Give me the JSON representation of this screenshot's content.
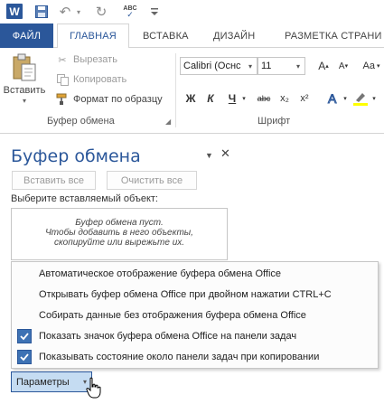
{
  "qat": {
    "word_logo": "W",
    "spell_top": "ABC",
    "spell_bottom": "✓",
    "icons": [
      "word-logo-icon",
      "save-icon",
      "undo-icon",
      "redo-icon",
      "spelling-icon",
      "customize-icon"
    ]
  },
  "tabs": {
    "file": "ФАЙЛ",
    "home": "ГЛАВНАЯ",
    "insert": "ВСТАВКА",
    "design": "ДИЗАЙН",
    "layout": "РАЗМЕТКА СТРАНИ"
  },
  "ribbon": {
    "paste": "Вставить",
    "cut": "Вырезать",
    "copy": "Копировать",
    "format_painter": "Формат по образцу",
    "clipboard_group": "Буфер обмена",
    "font_group": "Шрифт",
    "font_name": "Calibri (Оснс",
    "font_size": "11",
    "grow": "A",
    "shrink": "A",
    "case": "Aa",
    "bold": "Ж",
    "italic": "К",
    "underline": "Ч",
    "strike": "abc",
    "subscript": "x₂",
    "superscript": "x²"
  },
  "pane": {
    "title": "Буфер обмена",
    "close": "✕",
    "paste_all": "Вставить все",
    "clear_all": "Очистить все",
    "prompt": "Выберите вставляемый объект:",
    "empty_line1": "Буфер обмена пуст.",
    "empty_line2": "Чтобы добавить в него объекты,",
    "empty_line3": "скопируйте или вырежьте их."
  },
  "options_menu": {
    "items": [
      {
        "label": "Автоматическое отображение буфера обмена Office",
        "checked": false
      },
      {
        "label": "Открывать буфер обмена Office при двойном нажатии CTRL+C",
        "checked": false
      },
      {
        "label": "Собирать данные без отображения буфера обмена Office",
        "checked": false
      },
      {
        "label": "Показать значок буфера обмена Office на панели задач",
        "checked": true
      },
      {
        "label": "Показывать состояние около панели задач при копировании",
        "checked": true
      }
    ],
    "button": "Параметры"
  },
  "colors": {
    "accent": "#2b579a",
    "check": "#3d72b4",
    "options_button": "#c5dcf2",
    "font_color": "#2b579a",
    "highlight": "#ffff00"
  }
}
